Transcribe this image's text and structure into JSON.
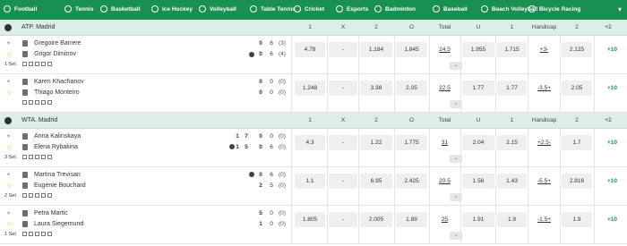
{
  "nav": {
    "items": [
      {
        "label": "Football",
        "icon": "football-icon"
      },
      {
        "label": "Tennis",
        "icon": "tennis-icon"
      },
      {
        "label": "Basketball",
        "icon": "basketball-icon"
      },
      {
        "label": "Ice Hockey",
        "icon": "ice-hockey-icon"
      },
      {
        "label": "Volleyball",
        "icon": "volleyball-icon"
      },
      {
        "label": "Table Tennis",
        "icon": "table-tennis-icon"
      },
      {
        "label": "Cricket",
        "icon": "cricket-icon"
      },
      {
        "label": "Esports",
        "icon": "esports-icon"
      },
      {
        "label": "Badminton",
        "icon": "badminton-icon"
      },
      {
        "label": "Baseball",
        "icon": "baseball-icon"
      },
      {
        "label": "Beach Volleyball",
        "icon": "beach-volleyball-icon"
      },
      {
        "label": "Bicycle Racing",
        "icon": "bicycle-racing-icon"
      }
    ],
    "more_icon": "chevron-down-icon"
  },
  "colors": {
    "nav_bg": "#198f52",
    "league_bg": "#ddeee6",
    "odd_bg": "#efefef",
    "accent": "#1c8a51",
    "star": "#e3b000"
  },
  "columns": {
    "c1": "1",
    "x": "X",
    "c2": "2",
    "o": "O",
    "total": "Total",
    "u": "U",
    "h1": "1",
    "handicap": "Handicap",
    "h2": "2"
  },
  "leagues": [
    {
      "name": "ATP. Madrid",
      "more": "+2",
      "matches": [
        {
          "p1": "Gregoire Barrere",
          "p2": "Grigor Dimitrov",
          "set": "1 Set",
          "s1": [
            "0",
            "6",
            "(3)"
          ],
          "s2": [
            "0",
            "6",
            "(4)"
          ],
          "extra1": [],
          "extra2": [],
          "odds": [
            "4.78",
            "-",
            "1.184",
            "1.845",
            "24.5",
            "1.955",
            "1.715",
            "+3-",
            "2.125"
          ],
          "more": "+10"
        },
        {
          "p1": "Karen Khachanov",
          "p2": "Thiago Monteiro",
          "set": "",
          "s1": [
            "0",
            "0",
            "(0)"
          ],
          "s2": [
            "0",
            "0",
            "(0)"
          ],
          "extra1": [],
          "extra2": [],
          "odds": [
            "1.248",
            "-",
            "3.98",
            "2.05",
            "22.5",
            "1.77",
            "1.77",
            "-3.5+",
            "2.05"
          ],
          "more": "+10"
        }
      ]
    },
    {
      "name": "WTA. Madrid",
      "more": "+2",
      "matches": [
        {
          "p1": "Anna Kalinskaya",
          "p2": "Elena Rybakina",
          "set": "3 Set",
          "s1": [
            "0",
            "0",
            "(0)"
          ],
          "s2": [
            "0",
            "6",
            "(0)"
          ],
          "extra1": [
            "1",
            "7"
          ],
          "extra2": [
            "1",
            "5"
          ],
          "odds": [
            "4.3",
            "-",
            "1.22",
            "1.775",
            "31",
            "2.04",
            "2.15",
            "+2.5-",
            "1.7"
          ],
          "more": "+10"
        },
        {
          "p1": "Martina Trevisan",
          "p2": "Eugenie Bouchard",
          "set": "2 Set",
          "s1": [
            "0",
            "6",
            "(0)"
          ],
          "s2": [
            "2",
            "5",
            "(0)"
          ],
          "extra1": [],
          "extra2": [],
          "odds": [
            "1.1",
            "-",
            "6.95",
            "2.425",
            "20.5",
            "1.56",
            "1.43",
            "-5.5+",
            "2.816"
          ],
          "more": "+10"
        },
        {
          "p1": "Petra Martic",
          "p2": "Laura Siegemund",
          "set": "1 Set",
          "s1": [
            "5",
            "0",
            "(0)"
          ],
          "s2": [
            "1",
            "0",
            "(0)"
          ],
          "extra1": [],
          "extra2": [],
          "odds": [
            "1.805",
            "-",
            "2.005",
            "1.89",
            "25",
            "1.91",
            "1.9",
            "-1.5+",
            "1.9"
          ],
          "more": "+10"
        }
      ]
    }
  ]
}
